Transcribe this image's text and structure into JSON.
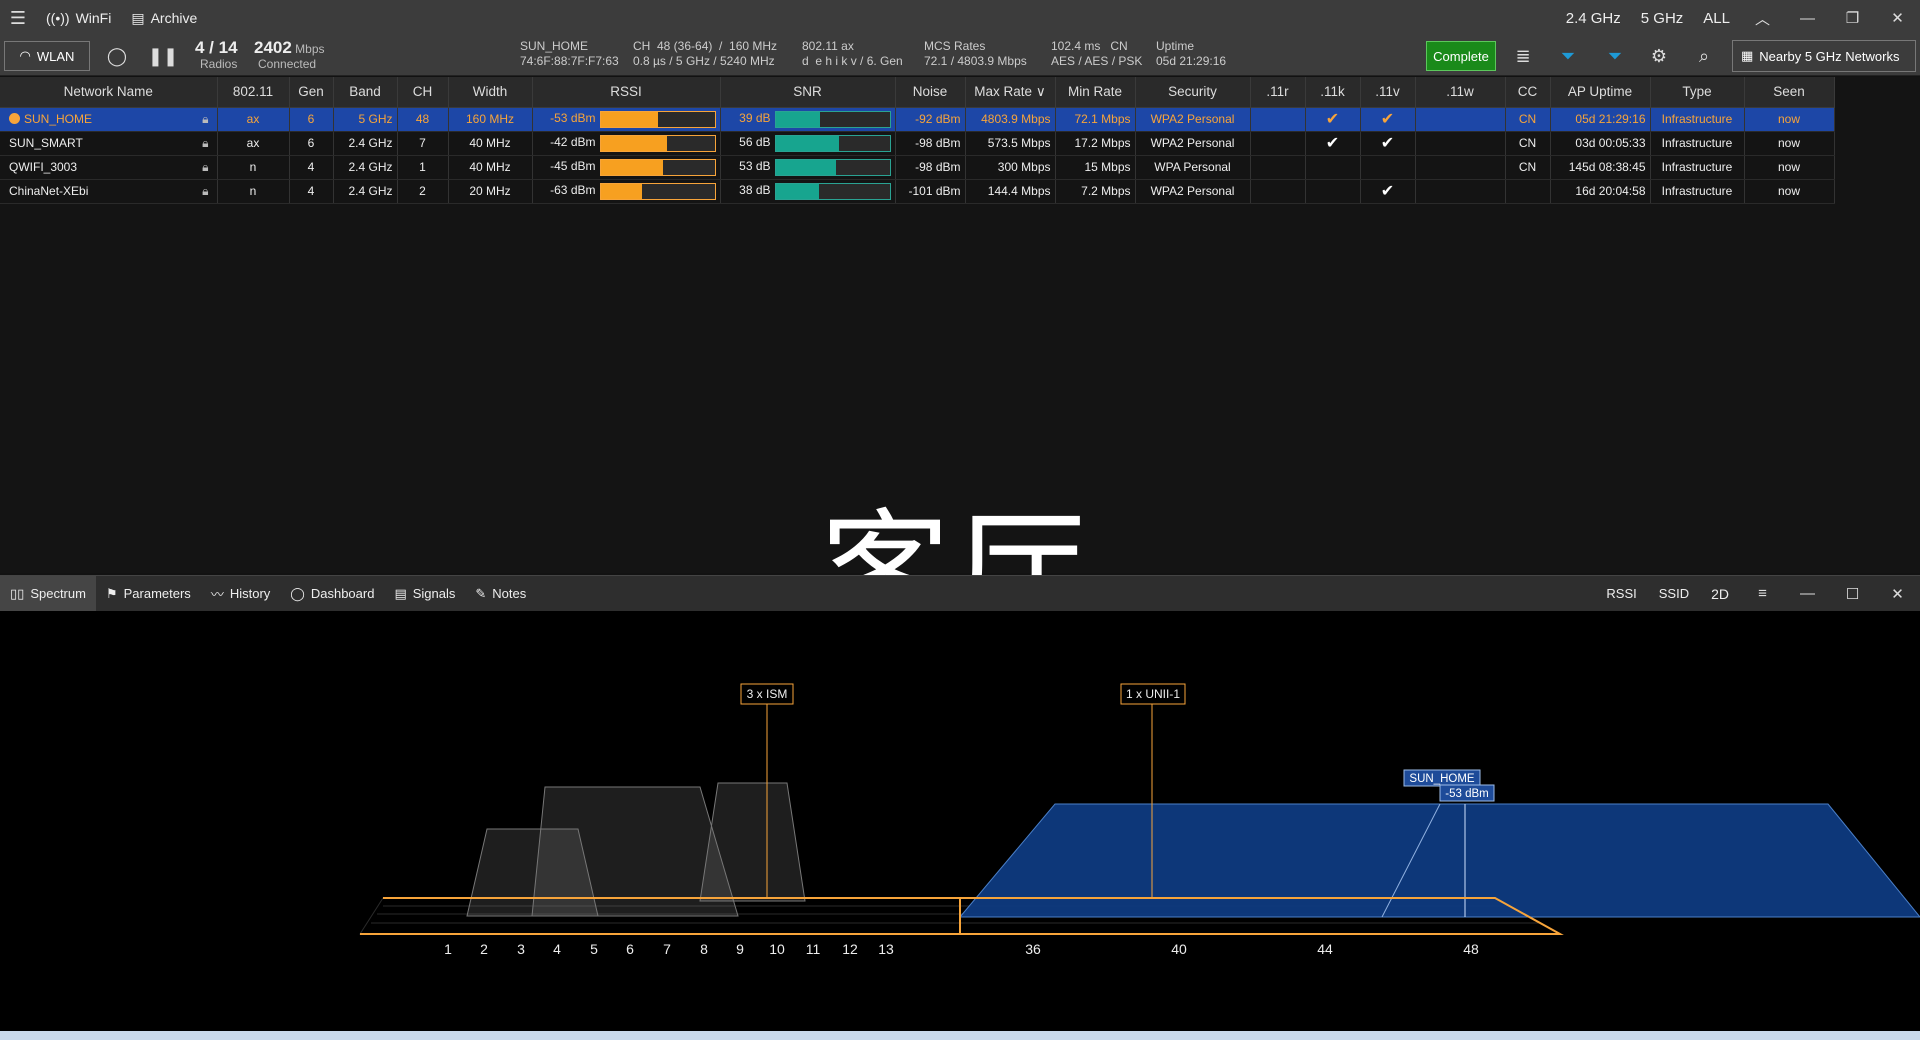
{
  "titlebar": {
    "app_name": "WinFi",
    "archive": "Archive",
    "bands": [
      "2.4 GHz",
      "5 GHz",
      "ALL"
    ]
  },
  "toolbar": {
    "wlan": "WLAN",
    "radios_value": "4 / 14",
    "radios_label": "Radios",
    "speed_value": "2402",
    "speed_unit": "Mbps",
    "speed_label": "Connected",
    "ssid": "SUN_HOME",
    "bssid": "74:6F:88:7F:F7:63",
    "ch_line1": "CH  48 (36-64)  /  160 MHz",
    "ch_line2": "0.8 µs / 5 GHz / 5240 MHz",
    "std_line1": "802.11 ax",
    "std_line2": "d  e h i k v / 6. Gen",
    "mcs_line1": "MCS Rates",
    "mcs_line2": "72.1 / 4803.9 Mbps",
    "sec_line1": "102.4 ms   CN",
    "sec_line2": "AES / AES / PSK",
    "uptime_line1": "Uptime",
    "uptime_line2": "05d 21:29:16",
    "complete": "Complete",
    "nearby": "Nearby 5 GHz Networks"
  },
  "table": {
    "headers": [
      "Network Name",
      "802.11",
      "Gen",
      "Band",
      "CH",
      "Width",
      "RSSI",
      "SNR",
      "Noise",
      "Max Rate",
      "Min Rate",
      "Security",
      ".11r",
      ".11k",
      ".11v",
      ".11w",
      "CC",
      "AP Uptime",
      "Type",
      "Seen"
    ],
    "rows": [
      {
        "name": "SUN_HOME",
        "std": "ax",
        "gen": "6",
        "band": "5 GHz",
        "ch": "48",
        "width": "160 MHz",
        "rssi": "-53 dBm",
        "rssi_level": 0.5,
        "snr": "39 dB",
        "snr_level": 0.39,
        "noise": "-92 dBm",
        "max": "4803.9 Mbps",
        "min": "72.1 Mbps",
        "sec": "WPA2 Personal",
        "r11": "",
        "k11": "✔",
        "v11": "✔",
        "w11": "",
        "cc": "CN",
        "uptime": "05d 21:29:16",
        "type": "Infrastructure",
        "seen": "now"
      },
      {
        "name": "SUN_SMART",
        "std": "ax",
        "gen": "6",
        "band": "2.4 GHz",
        "ch": "7",
        "width": "40 MHz",
        "rssi": "-42 dBm",
        "rssi_level": 0.58,
        "snr": "56 dB",
        "snr_level": 0.56,
        "noise": "-98 dBm",
        "max": "573.5 Mbps",
        "min": "17.2 Mbps",
        "sec": "WPA2 Personal",
        "r11": "",
        "k11": "✔",
        "v11": "✔",
        "w11": "",
        "cc": "CN",
        "uptime": "03d 00:05:33",
        "type": "Infrastructure",
        "seen": "now"
      },
      {
        "name": "QWIFI_3003",
        "std": "n",
        "gen": "4",
        "band": "2.4 GHz",
        "ch": "1",
        "width": "40 MHz",
        "rssi": "-45 dBm",
        "rssi_level": 0.55,
        "snr": "53 dB",
        "snr_level": 0.53,
        "noise": "-98 dBm",
        "max": "300 Mbps",
        "min": "15 Mbps",
        "sec": "WPA Personal",
        "r11": "",
        "k11": "",
        "v11": "",
        "w11": "",
        "cc": "CN",
        "uptime": "145d 08:38:45",
        "type": "Infrastructure",
        "seen": "now"
      },
      {
        "name": "ChinaNet-XEbi",
        "std": "n",
        "gen": "4",
        "band": "2.4 GHz",
        "ch": "2",
        "width": "20 MHz",
        "rssi": "-63 dBm",
        "rssi_level": 0.36,
        "snr": "38 dB",
        "snr_level": 0.38,
        "noise": "-101 dBm",
        "max": "144.4 Mbps",
        "min": "7.2 Mbps",
        "sec": "WPA2 Personal",
        "r11": "",
        "k11": "",
        "v11": "✔",
        "w11": "",
        "cc": "",
        "uptime": "16d 20:04:58",
        "type": "Infrastructure",
        "seen": "now"
      }
    ]
  },
  "watermark": "客厅",
  "tabs": [
    "Spectrum",
    "Parameters",
    "History",
    "Dashboard",
    "Signals",
    "Notes"
  ],
  "tab_right": [
    "RSSI",
    "SSID",
    "2D"
  ],
  "spectrum": {
    "label_ism": "3 x ISM",
    "label_unii": "1 x UNII-1",
    "network_label": "SUN_HOME",
    "network_rssi": "-53 dBm",
    "channels_24": [
      "1",
      "2",
      "3",
      "4",
      "5",
      "6",
      "7",
      "8",
      "9",
      "10",
      "11",
      "12",
      "13"
    ],
    "channels_5": [
      "36",
      "40",
      "44",
      "48"
    ]
  },
  "colors": {
    "selected_row": "#1d47a7",
    "orange": "#f7a43a",
    "teal": "#17a58f",
    "complete_green": "#1a8a1a",
    "spectrum_blue": "#0e3a80"
  }
}
